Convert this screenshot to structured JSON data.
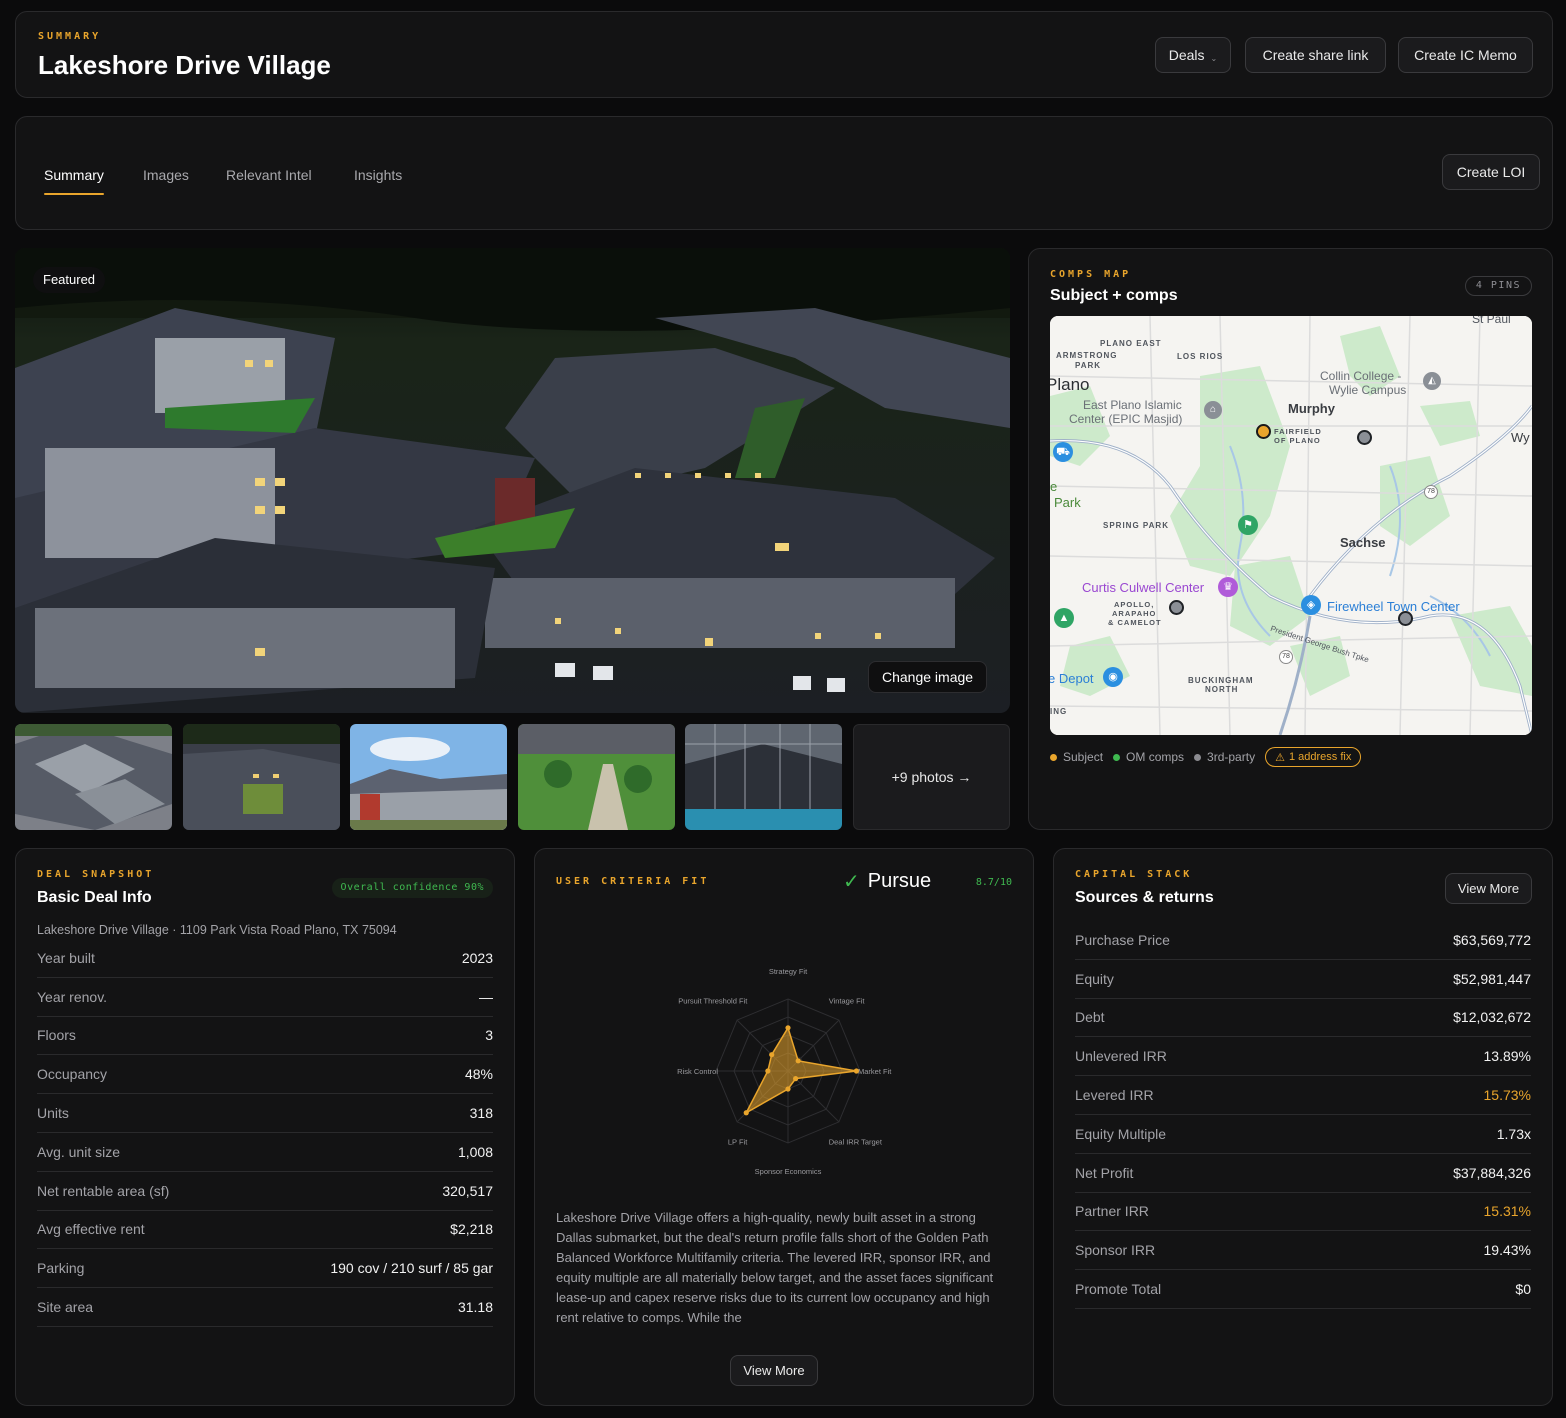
{
  "header": {
    "eyebrow": "SUMMARY",
    "title": "Lakeshore Drive Village",
    "deals_label": "Deals",
    "share_label": "Create share link",
    "memo_label": "Create IC Memo"
  },
  "tabs": {
    "items": [
      "Summary",
      "Images",
      "Relevant Intel",
      "Insights"
    ],
    "active": "Summary",
    "loi_label": "Create LOI"
  },
  "gallery": {
    "featured_badge": "Featured",
    "change_image_label": "Change image",
    "more_photos_label": "+9 photos →"
  },
  "map": {
    "eyebrow": "COMPS MAP",
    "title": "Subject + comps",
    "pins_badge": "4 PINS",
    "places": {
      "st_paul": "St Paul",
      "plano_east": "PLANO EAST",
      "armstrong": "ARMSTRONG",
      "park_small": "PARK",
      "los_rios": "LOS RIOS",
      "plano": "Plano",
      "collin_1": "Collin College -",
      "collin_2": "Wylie Campus",
      "east_plano_1": "East Plano Islamic",
      "east_plano_2": "Center (EPIC Masjid)",
      "murphy": "Murphy",
      "fairfield_1": "FAIRFIELD",
      "fairfield_2": "OF PLANO",
      "wy": "Wy",
      "e": "e",
      "park": "Park",
      "spring_park": "SPRING PARK",
      "sachse": "Sachse",
      "curtis": "Curtis Culwell Center",
      "apollo_1": "APOLLO,",
      "apollo_2": "ARAPAHO",
      "apollo_3": "& CAMELOT",
      "firewheel": "Firewheel Town Center",
      "tpke": "President George Bush Tpke",
      "depot": "e Depot",
      "buckingham_1": "BUCKINGHAM",
      "buckingham_2": "NORTH",
      "ing": "ING",
      "route_78": "78"
    },
    "legend": {
      "subject": "Subject",
      "om": "OM comps",
      "third": "3rd-party",
      "fix": "1 address fix"
    },
    "colors": {
      "subject": "#e9a52c",
      "om": "#3fb950",
      "third": "#8b8b90"
    }
  },
  "deal": {
    "eyebrow": "DEAL SNAPSHOT",
    "title": "Basic Deal Info",
    "confidence": "Overall confidence 90%",
    "address": "Lakeshore Drive Village · 1109 Park Vista Road Plano, TX 75094",
    "rows": [
      {
        "k": "Year built",
        "v": "2023"
      },
      {
        "k": "Year renov.",
        "v": "—"
      },
      {
        "k": "Floors",
        "v": "3"
      },
      {
        "k": "Occupancy",
        "v": "48%"
      },
      {
        "k": "Units",
        "v": "318"
      },
      {
        "k": "Avg. unit size",
        "v": "1,008"
      },
      {
        "k": "Net rentable area (sf)",
        "v": "320,517"
      },
      {
        "k": "Avg effective rent",
        "v": "$2,218"
      },
      {
        "k": "Parking",
        "v": "190 cov / 210 surf / 85 gar"
      },
      {
        "k": "Site area",
        "v": "31.18"
      }
    ]
  },
  "criteria": {
    "eyebrow": "USER CRITERIA FIT",
    "verdict": "Pursue",
    "score": "8.7/10",
    "axes": [
      "Strategy Fit",
      "Vintage Fit",
      "Market Fit",
      "Deal IRR Target",
      "Sponsor Economics",
      "LP Fit",
      "Risk Control",
      "Pursuit Threshold Fit"
    ],
    "values": [
      0.6,
      0.2,
      0.95,
      0.15,
      0.25,
      0.82,
      0.28,
      0.32
    ],
    "description": "Lakeshore Drive Village offers a high-quality, newly built asset in a strong Dallas submarket, but the deal's return profile falls short of the Golden Path Balanced Workforce Multifamily criteria. The levered IRR, sponsor IRR, and equity multiple are all materially below target, and the asset faces significant lease-up and capex reserve risks due to its current low occupancy and high rent relative to comps. While the",
    "view_more": "View More"
  },
  "capital": {
    "eyebrow": "CAPITAL STACK",
    "title": "Sources & returns",
    "view_more": "View More",
    "rows": [
      {
        "k": "Purchase Price",
        "v": "$63,569,772"
      },
      {
        "k": "Equity",
        "v": "$52,981,447"
      },
      {
        "k": "Debt",
        "v": "$12,032,672"
      },
      {
        "k": "Unlevered IRR",
        "v": "13.89%"
      },
      {
        "k": "Levered IRR",
        "v": "15.73%",
        "accent": true
      },
      {
        "k": "Equity Multiple",
        "v": "1.73x"
      },
      {
        "k": "Net Profit",
        "v": "$37,884,326"
      },
      {
        "k": "Partner IRR",
        "v": "15.31%",
        "accent": true
      },
      {
        "k": "Sponsor IRR",
        "v": "19.43%"
      },
      {
        "k": "Promote Total",
        "v": "$0"
      }
    ]
  },
  "colors": {
    "accent": "#e9a52c",
    "green": "#3fb950"
  }
}
